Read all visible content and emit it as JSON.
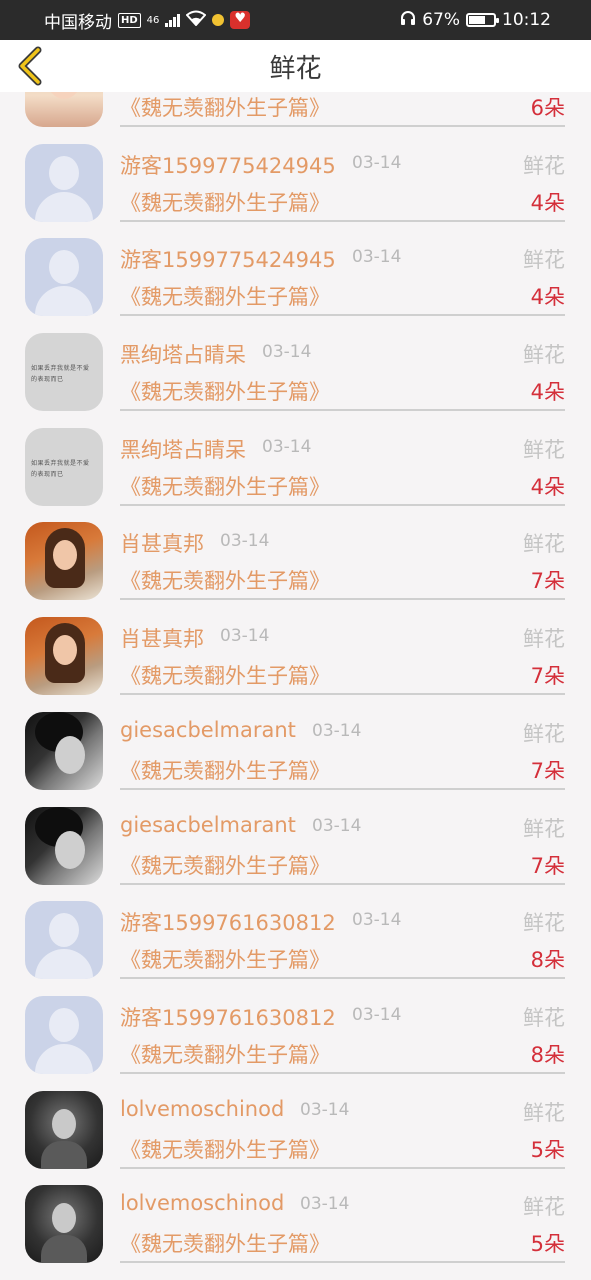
{
  "status_bar": {
    "carrier": "中国移动",
    "hd": "HD",
    "network": "46",
    "battery_percent": "67%",
    "battery_level": 0.67,
    "time": "10:12"
  },
  "nav": {
    "title": "鲜花",
    "back_icon": "chevron-left-icon"
  },
  "items": [
    {
      "avatar": "child",
      "name": "",
      "date": "",
      "type": "",
      "book": "《魏无羡翻外生子篇》",
      "count": "6朵"
    },
    {
      "avatar": "default",
      "name": "游客1599775424945",
      "date": "03-14",
      "type": "鲜花",
      "book": "《魏无羡翻外生子篇》",
      "count": "4朵"
    },
    {
      "avatar": "default",
      "name": "游客1599775424945",
      "date": "03-14",
      "type": "鲜花",
      "book": "《魏无羡翻外生子篇》",
      "count": "4朵"
    },
    {
      "avatar": "text",
      "name": "黑绚塔占睛呆",
      "date": "03-14",
      "type": "鲜花",
      "book": "《魏无羡翻外生子篇》",
      "count": "4朵"
    },
    {
      "avatar": "text",
      "name": "黑绚塔占睛呆",
      "date": "03-14",
      "type": "鲜花",
      "book": "《魏无羡翻外生子篇》",
      "count": "4朵"
    },
    {
      "avatar": "girl-orange",
      "name": "肖甚真邦",
      "date": "03-14",
      "type": "鲜花",
      "book": "《魏无羡翻外生子篇》",
      "count": "7朵"
    },
    {
      "avatar": "girl-orange",
      "name": "肖甚真邦",
      "date": "03-14",
      "type": "鲜花",
      "book": "《魏无羡翻外生子篇》",
      "count": "7朵"
    },
    {
      "avatar": "bw",
      "name": "giesacbelmarant",
      "date": "03-14",
      "type": "鲜花",
      "book": "《魏无羡翻外生子篇》",
      "count": "7朵"
    },
    {
      "avatar": "bw",
      "name": "giesacbelmarant",
      "date": "03-14",
      "type": "鲜花",
      "book": "《魏无羡翻外生子篇》",
      "count": "7朵"
    },
    {
      "avatar": "default",
      "name": "游客1599761630812",
      "date": "03-14",
      "type": "鲜花",
      "book": "《魏无羡翻外生子篇》",
      "count": "8朵"
    },
    {
      "avatar": "default",
      "name": "游客1599761630812",
      "date": "03-14",
      "type": "鲜花",
      "book": "《魏无羡翻外生子篇》",
      "count": "8朵"
    },
    {
      "avatar": "curly",
      "name": "lolvemoschinod",
      "date": "03-14",
      "type": "鲜花",
      "book": "《魏无羡翻外生子篇》",
      "count": "5朵"
    },
    {
      "avatar": "curly",
      "name": "lolvemoschinod",
      "date": "03-14",
      "type": "鲜花",
      "book": "《魏无羡翻外生子篇》",
      "count": "5朵"
    }
  ],
  "avatar_text_scribble": "如果丢弃我就是不爱的表现而已",
  "colors": {
    "name": "#e39a66",
    "count": "#d42f3a",
    "muted": "#c4c4c4",
    "back_chevron": "#f0c419"
  }
}
